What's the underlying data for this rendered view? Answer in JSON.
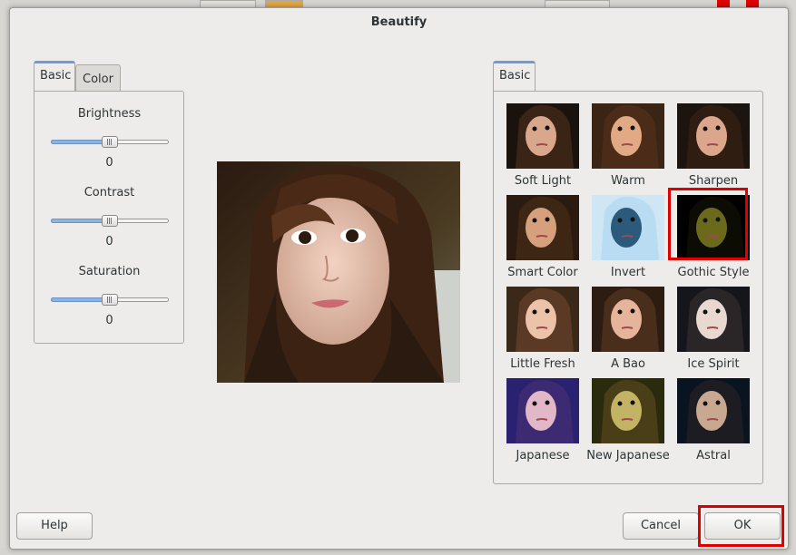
{
  "dialog": {
    "title": "Beautify"
  },
  "left_tabs": [
    {
      "label": "Basic",
      "active": true
    },
    {
      "label": "Color",
      "active": false
    }
  ],
  "adjustments": [
    {
      "label": "Brightness",
      "value": "0",
      "level": 0.5
    },
    {
      "label": "Contrast",
      "value": "0",
      "level": 0.5
    },
    {
      "label": "Saturation",
      "value": "0",
      "level": 0.5
    }
  ],
  "right_tabs": [
    {
      "label": "Basic",
      "active": true
    }
  ],
  "effects": [
    {
      "label": "Soft Light",
      "tint": "#1a120c",
      "skin": "#d9a78c",
      "hair": "#3a2416"
    },
    {
      "label": "Warm",
      "tint": "#3a2414",
      "skin": "#e2aa84",
      "hair": "#4b2c18"
    },
    {
      "label": "Sharpen",
      "tint": "#1b140f",
      "skin": "#dba68c",
      "hair": "#2f1d12"
    },
    {
      "label": "Smart Color",
      "tint": "#2a1a10",
      "skin": "#d6a07c",
      "hair": "#3e2614"
    },
    {
      "label": "Invert",
      "tint": "#cfe6f5",
      "skin": "#2b5a7a",
      "hair": "#b9dcf2"
    },
    {
      "label": "Gothic Style",
      "tint": "#000000",
      "skin": "#6b6a1c",
      "hair": "#0c0c04"
    },
    {
      "label": "Little Fresh",
      "tint": "#3a2818",
      "skin": "#ecc2a8",
      "hair": "#5a3a24"
    },
    {
      "label": "A Bao",
      "tint": "#2c1c12",
      "skin": "#e6b49a",
      "hair": "#4a2e1c"
    },
    {
      "label": "Ice Spirit",
      "tint": "#14161c",
      "skin": "#e8d8d0",
      "hair": "#2a2628"
    },
    {
      "label": "Japanese",
      "tint": "#2a2270",
      "skin": "#e2b8c8",
      "hair": "#3c2a72"
    },
    {
      "label": "New Japanese",
      "tint": "#2a2a0c",
      "skin": "#c2b464",
      "hair": "#4a3e18"
    },
    {
      "label": "Astral",
      "tint": "#0a1420",
      "skin": "#c8a890",
      "hair": "#1c1c22"
    }
  ],
  "selected_effect": "Gothic Style",
  "buttons": {
    "help": "Help",
    "cancel": "Cancel",
    "ok": "OK"
  },
  "colors": {
    "accent": "#6d9bd8",
    "highlight": "#e00000"
  }
}
